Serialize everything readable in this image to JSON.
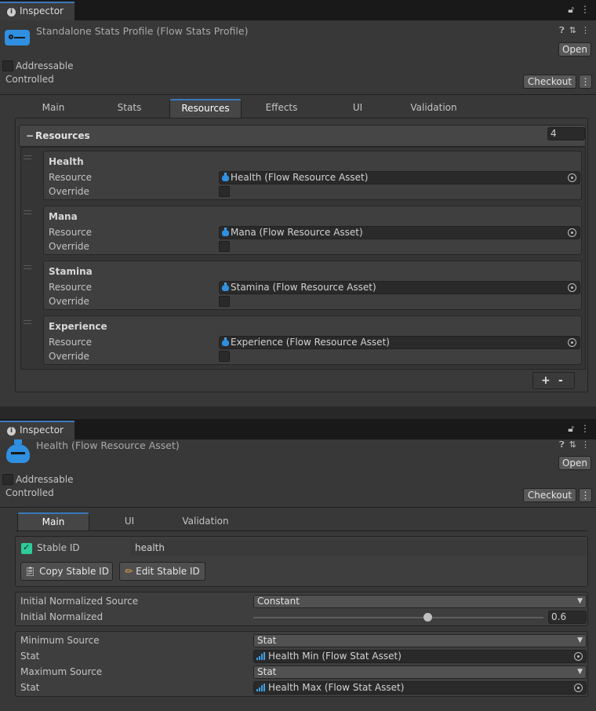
{
  "inspector1": {
    "tab_label": "Inspector",
    "title": "Standalone Stats Profile (Flow Stats Profile)",
    "open_label": "Open",
    "addressable_label": "Addressable",
    "controlled_label": "Controlled",
    "checkout_label": "Checkout",
    "more_label": "⋮",
    "tabs": [
      "Main",
      "Stats",
      "Resources",
      "Effects",
      "UI",
      "Validation"
    ],
    "active_tab": "Resources",
    "resources_header": "Resources",
    "resources_collapse": "−",
    "resources_count": "4",
    "resource_field_label": "Resource",
    "override_label": "Override",
    "resources": [
      {
        "name": "Health",
        "asset": "Health (Flow Resource Asset)"
      },
      {
        "name": "Mana",
        "asset": "Mana (Flow Resource Asset)"
      },
      {
        "name": "Stamina",
        "asset": "Stamina (Flow Resource Asset)"
      },
      {
        "name": "Experience",
        "asset": "Experience (Flow Resource Asset)"
      }
    ],
    "add_label": "+",
    "remove_label": "-"
  },
  "inspector2": {
    "tab_label": "Inspector",
    "title": "Health (Flow Resource Asset)",
    "open_label": "Open",
    "addressable_label": "Addressable",
    "controlled_label": "Controlled",
    "checkout_label": "Checkout",
    "more_label": "⋮",
    "tabs": [
      "Main",
      "UI",
      "Validation"
    ],
    "active_tab": "Main",
    "stable_id_label": "Stable ID",
    "stable_id_value": "health",
    "copy_stable_id_label": "Copy Stable ID",
    "edit_stable_id_label": "Edit Stable ID",
    "initial_normalized_source_label": "Initial Normalized Source",
    "initial_normalized_source_value": "Constant",
    "initial_normalized_label": "Initial Normalized",
    "initial_normalized_value": "0.6",
    "minimum_source_label": "Minimum Source",
    "minimum_source_value": "Stat",
    "stat_label": "Stat",
    "minimum_stat_value": "Health Min (Flow Stat Asset)",
    "maximum_source_label": "Maximum Source",
    "maximum_source_value": "Stat",
    "maximum_stat_value": "Health Max (Flow Stat Asset)"
  },
  "colors": {
    "accent": "#3a79bb",
    "asset_icon": "#2f8fe0",
    "checkbox_checked": "#2dcc9a"
  }
}
